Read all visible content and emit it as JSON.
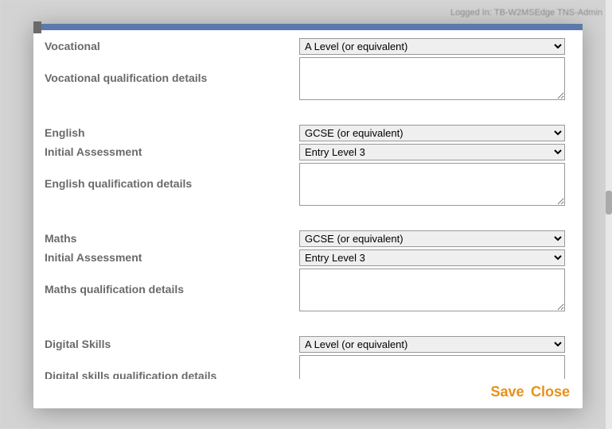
{
  "background": {
    "logged_in": "Logged In: TB-W2MSEdge TNS-Admin"
  },
  "modal": {
    "sections": {
      "vocational": {
        "label": "Vocational",
        "value": "A Level (or equivalent)",
        "details_label": "Vocational qualification details",
        "details_value": ""
      },
      "english": {
        "label": "English",
        "value": "GCSE (or equivalent)",
        "assessment_label": "Initial Assessment",
        "assessment_value": "Entry Level 3",
        "details_label": "English qualification details",
        "details_value": ""
      },
      "maths": {
        "label": "Maths",
        "value": "GCSE (or equivalent)",
        "assessment_label": "Initial Assessment",
        "assessment_value": "Entry Level 3",
        "details_label": "Maths qualification details",
        "details_value": ""
      },
      "digital": {
        "label": "Digital Skills",
        "value": "A Level (or equivalent)",
        "details_label": "Digital skills qualification details",
        "details_value": ""
      }
    },
    "footer": {
      "save": "Save",
      "close": "Close"
    }
  },
  "select_options": {
    "qualification": [
      "A Level (or equivalent)",
      "GCSE (or equivalent)"
    ],
    "assessment": [
      "Entry Level 3"
    ]
  }
}
